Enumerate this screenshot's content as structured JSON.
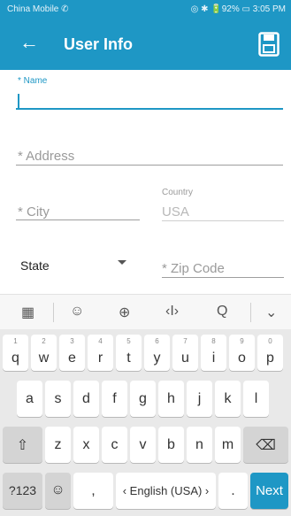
{
  "status": {
    "carrier": "China Mobile ✆",
    "right": "◎ ✱ 🔋92% ▭ 3:05 PM"
  },
  "appbar": {
    "back_icon": "arrow-left-icon",
    "title": "User Info",
    "save_icon": "save-floppy-icon"
  },
  "form": {
    "name_label": "* Name",
    "address_label": "* Address",
    "city_label": "* City",
    "country_label": "Country",
    "country_value": "USA",
    "state_label": "State",
    "zip_label": "* Zip Code"
  },
  "toolbar": [
    "▦",
    "☺",
    "⊕",
    "‹I›",
    "Q",
    "⌄"
  ],
  "keyboard": {
    "row1": [
      {
        "k": "q",
        "h": "1"
      },
      {
        "k": "w",
        "h": "2"
      },
      {
        "k": "e",
        "h": "3"
      },
      {
        "k": "r",
        "h": "4"
      },
      {
        "k": "t",
        "h": "5"
      },
      {
        "k": "y",
        "h": "6"
      },
      {
        "k": "u",
        "h": "7"
      },
      {
        "k": "i",
        "h": "8"
      },
      {
        "k": "o",
        "h": "9"
      },
      {
        "k": "p",
        "h": "0"
      }
    ],
    "row2": [
      "a",
      "s",
      "d",
      "f",
      "g",
      "h",
      "j",
      "k",
      "l"
    ],
    "row3": [
      "z",
      "x",
      "c",
      "v",
      "b",
      "n",
      "m"
    ],
    "shift": "⇧",
    "backspace": "⌫",
    "symbols": "?123",
    "emoji": "☺",
    "comma": ",",
    "space": "‹ English (USA) ›",
    "period": ".",
    "next": "Next"
  }
}
